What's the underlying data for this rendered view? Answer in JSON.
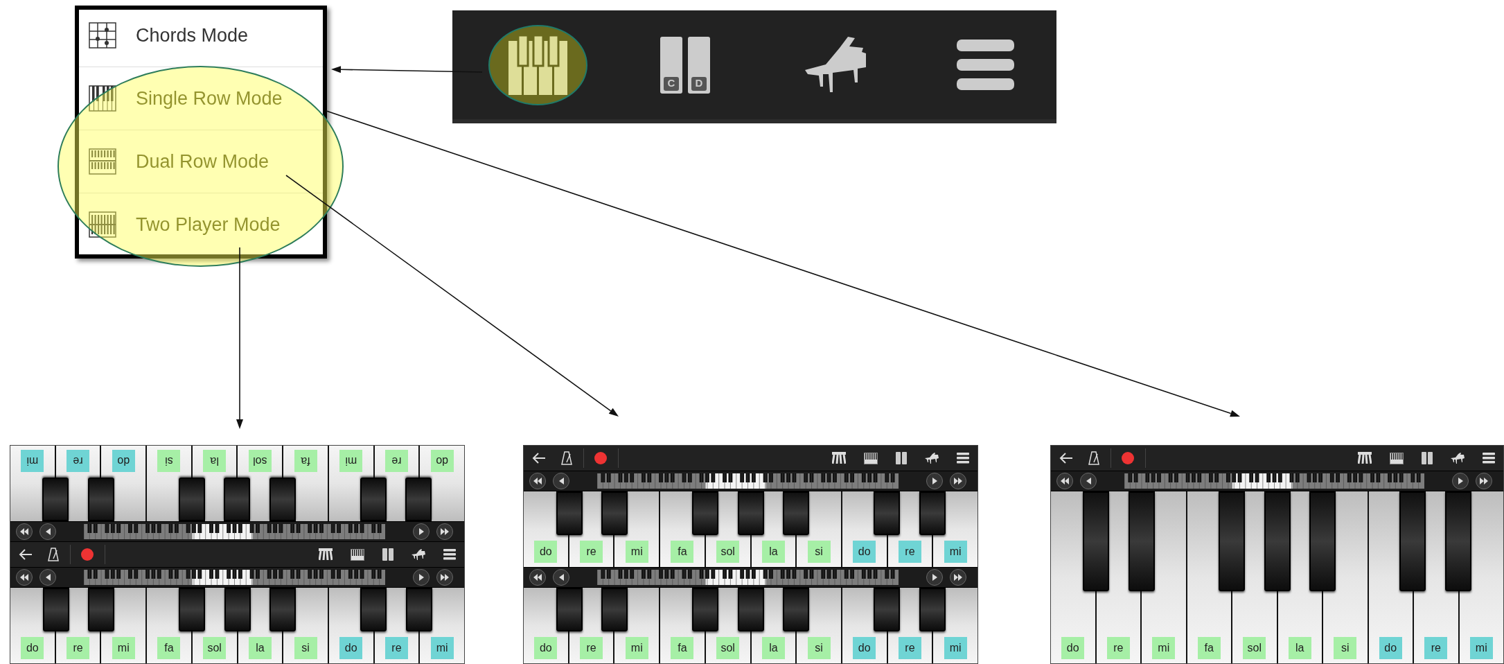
{
  "menu": {
    "items": [
      {
        "label": "Chords Mode",
        "kind": "chords",
        "highlighted": false
      },
      {
        "label": "Single Row Mode",
        "kind": "single_row",
        "highlighted": true
      },
      {
        "label": "Dual Row Mode",
        "kind": "dual_row",
        "highlighted": true
      },
      {
        "label": "Two Player Mode",
        "kind": "two_player",
        "highlighted": true
      }
    ]
  },
  "toolbar": {
    "buttons": [
      {
        "kind": "keys",
        "selected": true
      },
      {
        "kind": "split_keys",
        "selected": false,
        "letters": [
          "C",
          "D"
        ]
      },
      {
        "kind": "grand_piano",
        "selected": false
      },
      {
        "kind": "menu",
        "selected": false
      }
    ]
  },
  "screens": [
    {
      "parts": [
        {
          "kind": "keyboard",
          "flipped": true,
          "keys": [
            {
              "label": "do",
              "color": "#a6efa6"
            },
            {
              "label": "re",
              "color": "#a6efa6"
            },
            {
              "label": "mi",
              "color": "#a6efa6"
            },
            {
              "label": "fa",
              "color": "#a6efa6"
            },
            {
              "label": "sol",
              "color": "#a6efa6"
            },
            {
              "label": "la",
              "color": "#a6efa6"
            },
            {
              "label": "si",
              "color": "#a6efa6"
            },
            {
              "label": "do",
              "color": "#6fd4d4"
            },
            {
              "label": "re",
              "color": "#6fd4d4"
            },
            {
              "label": "mi",
              "color": "#6fd4d4"
            }
          ]
        },
        {
          "kind": "navigator"
        },
        {
          "kind": "toolbar"
        },
        {
          "kind": "navigator"
        },
        {
          "kind": "keyboard",
          "flipped": false,
          "keys": [
            {
              "label": "do",
              "color": "#a6efa6"
            },
            {
              "label": "re",
              "color": "#a6efa6"
            },
            {
              "label": "mi",
              "color": "#a6efa6"
            },
            {
              "label": "fa",
              "color": "#a6efa6"
            },
            {
              "label": "sol",
              "color": "#a6efa6"
            },
            {
              "label": "la",
              "color": "#a6efa6"
            },
            {
              "label": "si",
              "color": "#a6efa6"
            },
            {
              "label": "do",
              "color": "#6fd4d4"
            },
            {
              "label": "re",
              "color": "#6fd4d4"
            },
            {
              "label": "mi",
              "color": "#6fd4d4"
            }
          ]
        }
      ]
    },
    {
      "parts": [
        {
          "kind": "toolbar"
        },
        {
          "kind": "navigator"
        },
        {
          "kind": "keyboard",
          "flipped": false,
          "keys": [
            {
              "label": "do",
              "color": "#a6efa6"
            },
            {
              "label": "re",
              "color": "#a6efa6"
            },
            {
              "label": "mi",
              "color": "#a6efa6"
            },
            {
              "label": "fa",
              "color": "#a6efa6"
            },
            {
              "label": "sol",
              "color": "#a6efa6"
            },
            {
              "label": "la",
              "color": "#a6efa6"
            },
            {
              "label": "si",
              "color": "#a6efa6"
            },
            {
              "label": "do",
              "color": "#6fd4d4"
            },
            {
              "label": "re",
              "color": "#6fd4d4"
            },
            {
              "label": "mi",
              "color": "#6fd4d4"
            }
          ]
        },
        {
          "kind": "navigator"
        },
        {
          "kind": "keyboard",
          "flipped": false,
          "keys": [
            {
              "label": "do",
              "color": "#a6efa6"
            },
            {
              "label": "re",
              "color": "#a6efa6"
            },
            {
              "label": "mi",
              "color": "#a6efa6"
            },
            {
              "label": "fa",
              "color": "#a6efa6"
            },
            {
              "label": "sol",
              "color": "#a6efa6"
            },
            {
              "label": "la",
              "color": "#a6efa6"
            },
            {
              "label": "si",
              "color": "#a6efa6"
            },
            {
              "label": "do",
              "color": "#6fd4d4"
            },
            {
              "label": "re",
              "color": "#6fd4d4"
            },
            {
              "label": "mi",
              "color": "#6fd4d4"
            }
          ]
        }
      ]
    },
    {
      "parts": [
        {
          "kind": "toolbar"
        },
        {
          "kind": "navigator"
        },
        {
          "kind": "keyboard",
          "flipped": false,
          "keys": [
            {
              "label": "do",
              "color": "#a6efa6"
            },
            {
              "label": "re",
              "color": "#a6efa6"
            },
            {
              "label": "mi",
              "color": "#a6efa6"
            },
            {
              "label": "fa",
              "color": "#a6efa6"
            },
            {
              "label": "sol",
              "color": "#a6efa6"
            },
            {
              "label": "la",
              "color": "#a6efa6"
            },
            {
              "label": "si",
              "color": "#a6efa6"
            },
            {
              "label": "do",
              "color": "#6fd4d4"
            },
            {
              "label": "re",
              "color": "#6fd4d4"
            },
            {
              "label": "mi",
              "color": "#6fd4d4"
            }
          ]
        }
      ]
    }
  ]
}
